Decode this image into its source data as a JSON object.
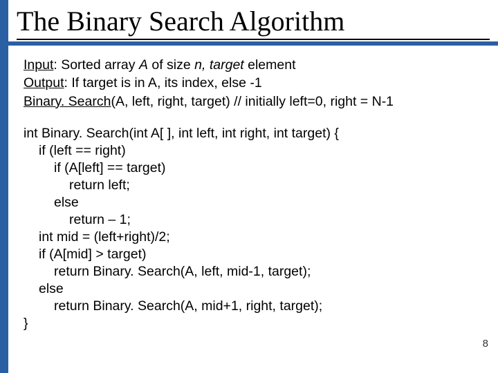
{
  "title": "The Binary Search Algorithm",
  "spec": {
    "input_label": "Input",
    "input_rest": ": Sorted array ",
    "input_A": "A",
    "input_mid": " of size ",
    "input_n": "n,  target ",
    "input_tail": "element",
    "output_label": "Output",
    "output_rest": ": If target is in A, its index, else -1",
    "call_label": "Binary. Search",
    "call_rest": "(A, left, right, target)   // initially left=0, right = N-1"
  },
  "code": {
    "l0": "int Binary. Search(int A[ ], int left, int right, int target) {",
    "l1": "if (left == right)",
    "l2": "if (A[left] == target)",
    "l3": "return left;",
    "l4": "else",
    "l5": "return – 1;",
    "l6": "int mid = (left+right)/2;",
    "l7": "if (A[mid] > target)",
    "l8": "return Binary. Search(A, left, mid-1, target);",
    "l9": "else",
    "l10": "return Binary. Search(A, mid+1, right, target);",
    "l11": "}"
  },
  "page_number": "8"
}
